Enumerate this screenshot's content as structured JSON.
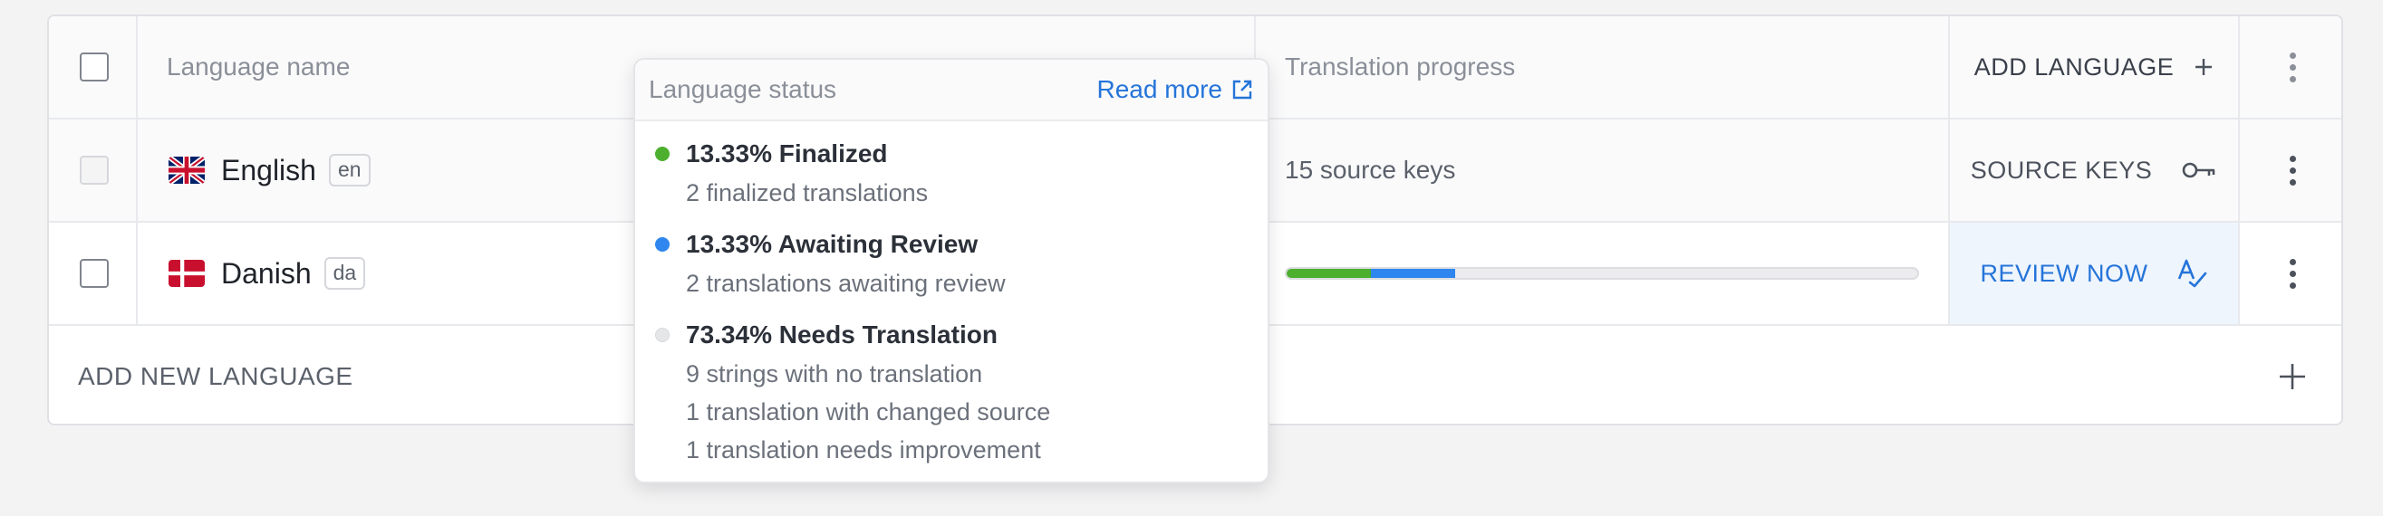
{
  "header": {
    "language_name_label": "Language name",
    "translation_progress_label": "Translation progress",
    "add_language_label": "ADD LANGUAGE"
  },
  "languages": [
    {
      "name": "English",
      "code": "en",
      "progress_text": "15 source keys",
      "action_label": "SOURCE KEYS",
      "action_icon": "key-icon",
      "flag": "uk-flag"
    },
    {
      "name": "Danish",
      "code": "da",
      "action_label": "REVIEW NOW",
      "action_icon": "spellcheck-icon",
      "flag": "denmark-flag",
      "progress": {
        "finalized": 0.1333,
        "awaiting_review": 0.1333,
        "needs_translation": 0.7334
      }
    }
  ],
  "add_new_language_label": "ADD NEW LANGUAGE",
  "popover": {
    "title": "Language status",
    "read_more_label": "Read more",
    "statuses": [
      {
        "title": "13.33% Finalized",
        "lines": [
          "2 finalized translations"
        ],
        "color": "#4caf2e"
      },
      {
        "title": "13.33% Awaiting Review",
        "lines": [
          "2 translations awaiting review"
        ],
        "color": "#2e86ee"
      },
      {
        "title": "73.34% Needs Translation",
        "lines": [
          "9 strings with no translation",
          "1 translation with changed source",
          "1 translation needs improvement"
        ],
        "color": "#e5e6e8"
      }
    ]
  },
  "colors": {
    "accent": "#2574d9",
    "finalized": "#4caf2e",
    "awaiting_review": "#2e86ee",
    "needs_translation": "#e5e6e8",
    "review_highlight": "#eef5fd"
  }
}
